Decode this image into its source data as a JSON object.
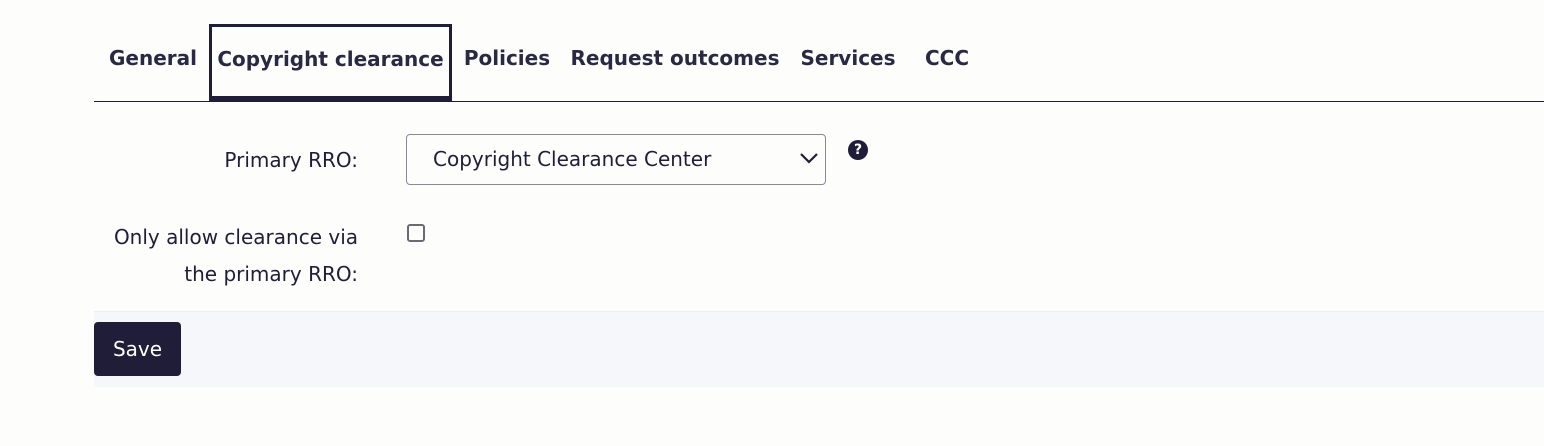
{
  "tabs": [
    {
      "label": "General",
      "active": false
    },
    {
      "label": "Copyright clearance",
      "active": true
    },
    {
      "label": "Policies",
      "active": false
    },
    {
      "label": "Request outcomes",
      "active": false
    },
    {
      "label": "Services",
      "active": false
    },
    {
      "label": "CCC",
      "active": false
    }
  ],
  "form": {
    "primary_rro": {
      "label": "Primary RRO:",
      "value": "Copyright Clearance Center",
      "help_icon": "question-circle-icon",
      "help_glyph": "?"
    },
    "only_allow": {
      "label_line1": "Only allow clearance via",
      "label_line2": "the primary RRO:",
      "checked": false
    }
  },
  "footer": {
    "save_label": "Save"
  },
  "colors": {
    "primary": "#1f1d38",
    "background": "#fdfdfb",
    "footer_background": "#f5f7fa"
  }
}
